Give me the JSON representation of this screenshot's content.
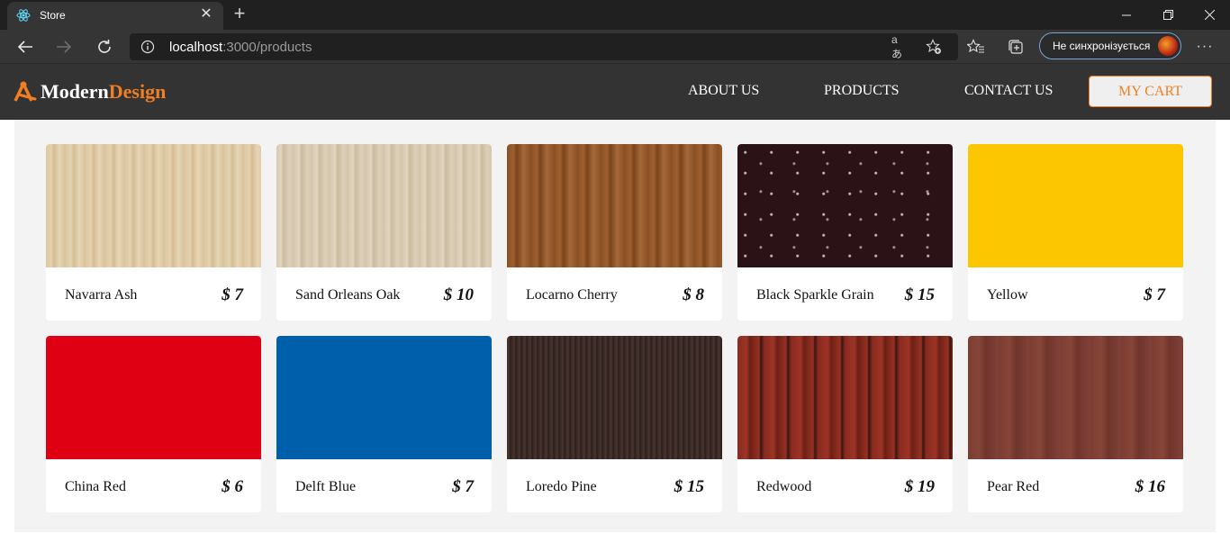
{
  "browser": {
    "tab_title": "Store",
    "url_host": "localhost",
    "url_path": ":3000/products",
    "profile_label": "Не синхронізується"
  },
  "site": {
    "logo_part1": "Modern",
    "logo_part2": "Design",
    "nav": {
      "about": "ABOUT US",
      "products": "PRODUCTS",
      "contact": "CONTACT US"
    },
    "cart_label": "MY CART",
    "accent_color": "#f07f23",
    "header_color": "#333333"
  },
  "products": [
    {
      "name": "Navarra Ash",
      "price": "$ 7",
      "swatch": "wood-light-ash"
    },
    {
      "name": "Sand Orleans Oak",
      "price": "$ 10",
      "swatch": "wood-sand-oak"
    },
    {
      "name": "Locarno Cherry",
      "price": "$ 8",
      "swatch": "wood-cherry"
    },
    {
      "name": "Black Sparkle Grain",
      "price": "$ 15",
      "swatch": "stone-dark-sparkle"
    },
    {
      "name": "Yellow",
      "price": "$ 7",
      "swatch": "#fcc600"
    },
    {
      "name": "China Red",
      "price": "$ 6",
      "swatch": "#df0014"
    },
    {
      "name": "Delft Blue",
      "price": "$ 7",
      "swatch": "#005fab"
    },
    {
      "name": "Loredo Pine",
      "price": "$ 15",
      "swatch": "wood-dark-pine"
    },
    {
      "name": "Redwood",
      "price": "$ 19",
      "swatch": "wood-redwood"
    },
    {
      "name": "Pear Red",
      "price": "$ 16",
      "swatch": "wood-pear"
    }
  ]
}
